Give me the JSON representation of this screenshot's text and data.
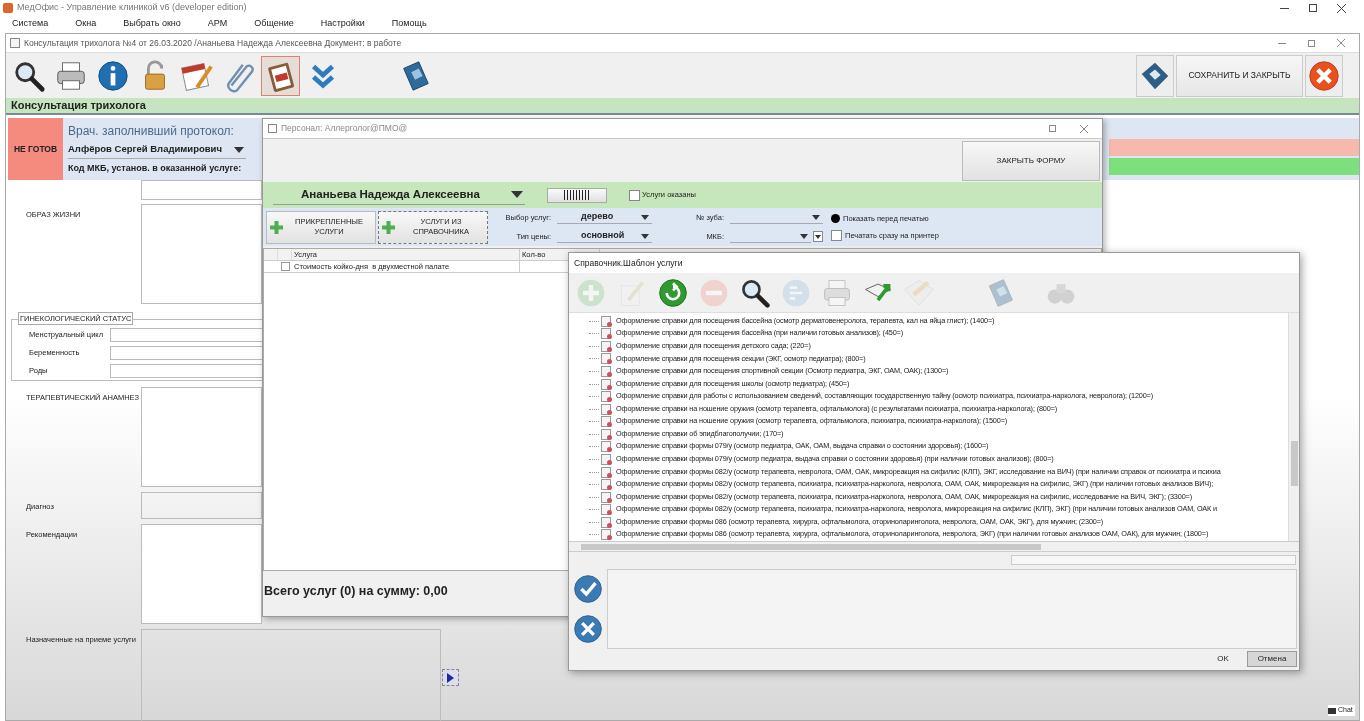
{
  "app": {
    "title": "МедОфис - Управление клиникой v6 (developer edition)"
  },
  "menu": [
    "Система",
    "Окна",
    "Выбрать окно",
    "АРМ",
    "Общение",
    "Настройки",
    "Помощь"
  ],
  "document": {
    "title": "Консультация трихолога №4 от 26.03.2020 /Ананьева Надежда Алексеевна Документ: в работе",
    "toolbar": [
      {
        "kind": "search",
        "selected": false
      },
      {
        "kind": "printer",
        "selected": false
      },
      {
        "kind": "info",
        "selected": false
      },
      {
        "kind": "lock",
        "selected": false
      },
      {
        "kind": "calendar",
        "selected": false
      },
      {
        "kind": "clip",
        "selected": false
      },
      {
        "kind": "clipboard",
        "selected": true
      },
      {
        "kind": "chevrons",
        "selected": false
      },
      {
        "kind": "book",
        "selected": false
      }
    ],
    "save_button": "СОХРАНИТЬ И ЗАКРЫТЬ",
    "heading": "Консультация трихолога",
    "status": "НЕ ГОТОВ",
    "doctor_label": "Врач. заполнивший протокол:",
    "doctor": "Алфёров Сергей Владимирович",
    "mkb_label": "Код МКБ, установ. в оказанной услуге:",
    "fields": [
      {
        "kind": "area",
        "label": "ОБРАЗ ЖИЗНИ"
      },
      {
        "kind": "group",
        "label": "ГИНЕКОЛОГИЧЕСКИЙ СТАТУС",
        "children": [
          {
            "label": "Менструальный цикл"
          },
          {
            "label": "Беременность"
          },
          {
            "label": "Роды"
          }
        ]
      },
      {
        "kind": "area",
        "label": "ТЕРАПЕВТИЧЕСКИЙ АНАМНЕЗ"
      },
      {
        "kind": "line",
        "label": "Диагноз"
      },
      {
        "kind": "area",
        "label": "Рекомендации"
      },
      {
        "kind": "services",
        "label": "Назначенные на приеме услуги"
      }
    ]
  },
  "staff_dialog": {
    "title": "Персонал: Аллерголог@ПМО@",
    "close_button": "ЗАКРЫТЬ ФОРМУ",
    "patient": "Ананьева Надежда Алексеевна",
    "services_done": {
      "label": "Услуги оказаны",
      "checked": false
    },
    "add_buttons": [
      "ПРИКРЕПЛЕННЫЕ УСЛУГИ",
      "УСЛУГИ ИЗ СПРАВОЧНИКА"
    ],
    "service_choice": {
      "label": "Выбор услуг:",
      "value": "дерево"
    },
    "price_type": {
      "label": "Тип цены:",
      "value": "основной"
    },
    "tooth": {
      "label": "№ зуба:"
    },
    "mkb": {
      "label": "МКБ:"
    },
    "print_options": [
      {
        "label": "Показать перед печатью",
        "selected": true
      },
      {
        "label": "Печатать сразу на принтер",
        "selected": false
      }
    ],
    "table": {
      "columns": [
        "Услуга",
        "Кол-во"
      ],
      "rows": [
        {
          "service": "Стоимость койко-дня  в двухместной палате",
          "checked": false
        }
      ]
    },
    "total": "Всего услуг (0) на сумму: 0,00"
  },
  "template_dialog": {
    "title": "Справочник.Шаблон услуги",
    "toolbar": [
      {
        "kind": "plus",
        "disabled": true
      },
      {
        "kind": "pencil",
        "disabled": true
      },
      {
        "kind": "refresh",
        "disabled": false
      },
      {
        "kind": "minus",
        "disabled": true
      },
      {
        "kind": "search",
        "disabled": false
      },
      {
        "kind": "sort",
        "disabled": true
      },
      {
        "kind": "printer",
        "disabled": true
      },
      {
        "kind": "export",
        "disabled": false
      },
      {
        "kind": "import",
        "disabled": true
      },
      {
        "kind": "book",
        "disabled": true
      },
      {
        "kind": "binoculars",
        "disabled": true
      }
    ],
    "items": [
      "Оформление справки для посещения бассейна (осмотр дерматовенеролога, терапевта, кал на яйца глист); (1400=)",
      "Оформление справки для посещения бассейна (при наличии готовых анализов); (450=)",
      "Оформление справки для посещения детского сада; (220=)",
      "Оформление справки для посещения секции (ЭКГ, осмотр педиатра); (800=)",
      "Оформление справки для посещения спортивной секции (Осмотр педиатра, ЭКГ, ОАМ, ОАК); (1300=)",
      "Оформление справки для посещения школы (осмотр педиатра); (450=)",
      "Оформление справки для работы с использованием сведений, составляющих государственную тайну (осмотр психиатра, психиатра-нарколога, невролога); (1200=)",
      "Оформление справки на ношение оружия (осмотр терапевта, офтальмолога) (с результатами психиатра, психиатра-нарколога); (800=)",
      "Оформление справки на ношение оружия (осмотр терапевта, офтальмолога, психиатра, психиатра-нарколога); (1500=)",
      "Оформление справки об эпидблагополучии; (170=)",
      "Оформление справки формы 079/у (осмотр педиатра, ОАК, ОАМ, выдача справки о состоянии здоровья); (1600=)",
      "Оформление справки формы 079/у (осмотр педиатра, выдача справки о состоянии здоровья) (при наличии готовых анализов); (800=)",
      "Оформление справки формы 082/у (осмотр терапевта, невролога, ОАМ, ОАК, микрореакция на сифилис (КЛП), ЭКГ, исследование на ВИЧ) (при наличии справок от психиатра и психиа",
      "Оформление справки формы 082/у (осмотр терапевта, психиатра, психиатра-нарколога, невролога, ОАМ, ОАК, микрореакция на сифилис, ЭКГ) (при наличии готовых анализов ВИЧ);",
      "Оформление справки формы 082/у (осмотр терапевта, психиатра, психиатра-нарколога, невролога, ОАМ, ОАК, микрореакция на сифилис, исследование на ВИЧ, ЭКГ); (3300=)",
      "Оформление справки формы 082/у (осмотр терапевта, психиатра, психиатра-нарколога, невролога, микрореакция на сифилис (КЛП), ЭКГ) (при наличии готовых анализов ОАМ, ОАК и",
      "Оформление справки формы 086 (осмотр терапевта, хирурга, офтальмолога, оториноларинголога, невролога, ОАМ, ОАК, ЭКГ), для мужчин; (2300=)",
      "Оформление справки формы 086 (осмотр терапевта, хирурга, офтальмолога, оториноларинголога, невролога, ЭКГ) (при наличии готовых анализов ОАМ, ОАК), для мужчин; (1800=)"
    ],
    "buttons": [
      {
        "label": "OK",
        "selected": false
      },
      {
        "label": "Отмена",
        "selected": true
      }
    ]
  },
  "taskbar": {
    "chat": "Chat"
  }
}
